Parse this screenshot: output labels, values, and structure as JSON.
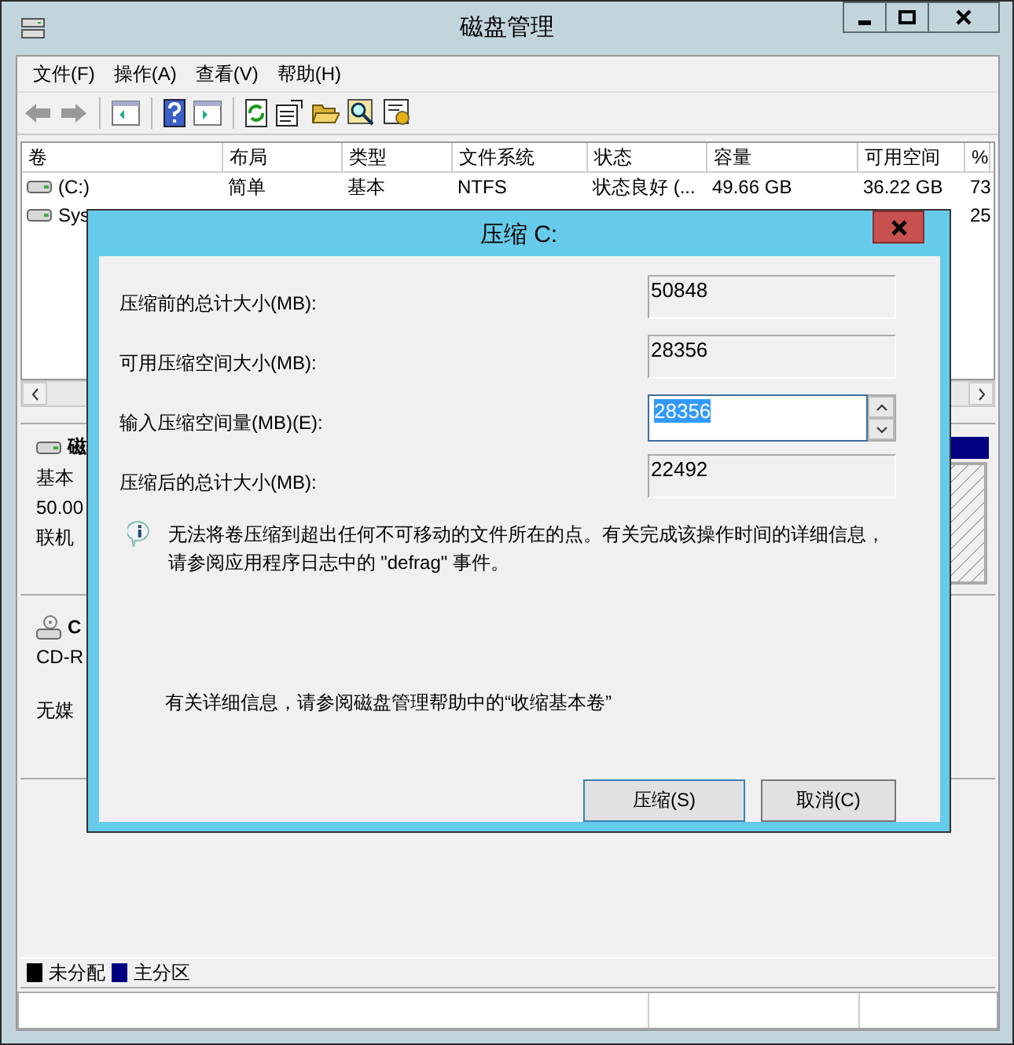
{
  "window": {
    "title": "磁盘管理"
  },
  "menu": [
    {
      "label": "文件(F)"
    },
    {
      "label": "操作(A)"
    },
    {
      "label": "查看(V)"
    },
    {
      "label": "帮助(H)"
    }
  ],
  "volume_table": {
    "columns": [
      "卷",
      "布局",
      "类型",
      "文件系统",
      "状态",
      "容量",
      "可用空间",
      "%"
    ],
    "rows": [
      {
        "volume": "(C:)",
        "layout": "简单",
        "type": "基本",
        "filesystem": "NTFS",
        "status": "状态良好 (...",
        "capacity": "49.66 GB",
        "free": "36.22 GB",
        "percent": "73",
        "kind": "disk"
      },
      {
        "volume": "Sys",
        "percent": "25",
        "kind": "disk"
      }
    ]
  },
  "disks": [
    {
      "kind": "disk",
      "name": "磁",
      "lines": [
        "基本",
        "50.00",
        "联机"
      ]
    },
    {
      "kind": "cdrom",
      "name": "C",
      "lines": [
        "CD-R",
        "无媒"
      ]
    }
  ],
  "legend": [
    {
      "label": "未分配",
      "color": "#000000"
    },
    {
      "label": "主分区",
      "color": "#000080"
    }
  ],
  "dialog": {
    "title": "压缩 C:",
    "fields": [
      {
        "label": "压缩前的总计大小(MB):",
        "value": "50848",
        "kind": "readonly"
      },
      {
        "label": "可用压缩空间大小(MB):",
        "value": "28356",
        "kind": "readonly"
      },
      {
        "label": "输入压缩空间量(MB)(E):",
        "value": "28356",
        "kind": "spinner",
        "value_selected": true
      },
      {
        "label": "压缩后的总计大小(MB):",
        "value": "22492",
        "kind": "readonly"
      }
    ],
    "info": "无法将卷压缩到超出任何不可移动的文件所在的点。有关完成该操作时间的详细信息，请参阅应用程序日志中的 \"defrag\" 事件。",
    "help_text": "有关详细信息，请参阅磁盘管理帮助中的“收缩基本卷”",
    "buttons": [
      {
        "label": "压缩(S)",
        "default": true
      },
      {
        "label": "取消(C)",
        "default": false
      }
    ]
  }
}
